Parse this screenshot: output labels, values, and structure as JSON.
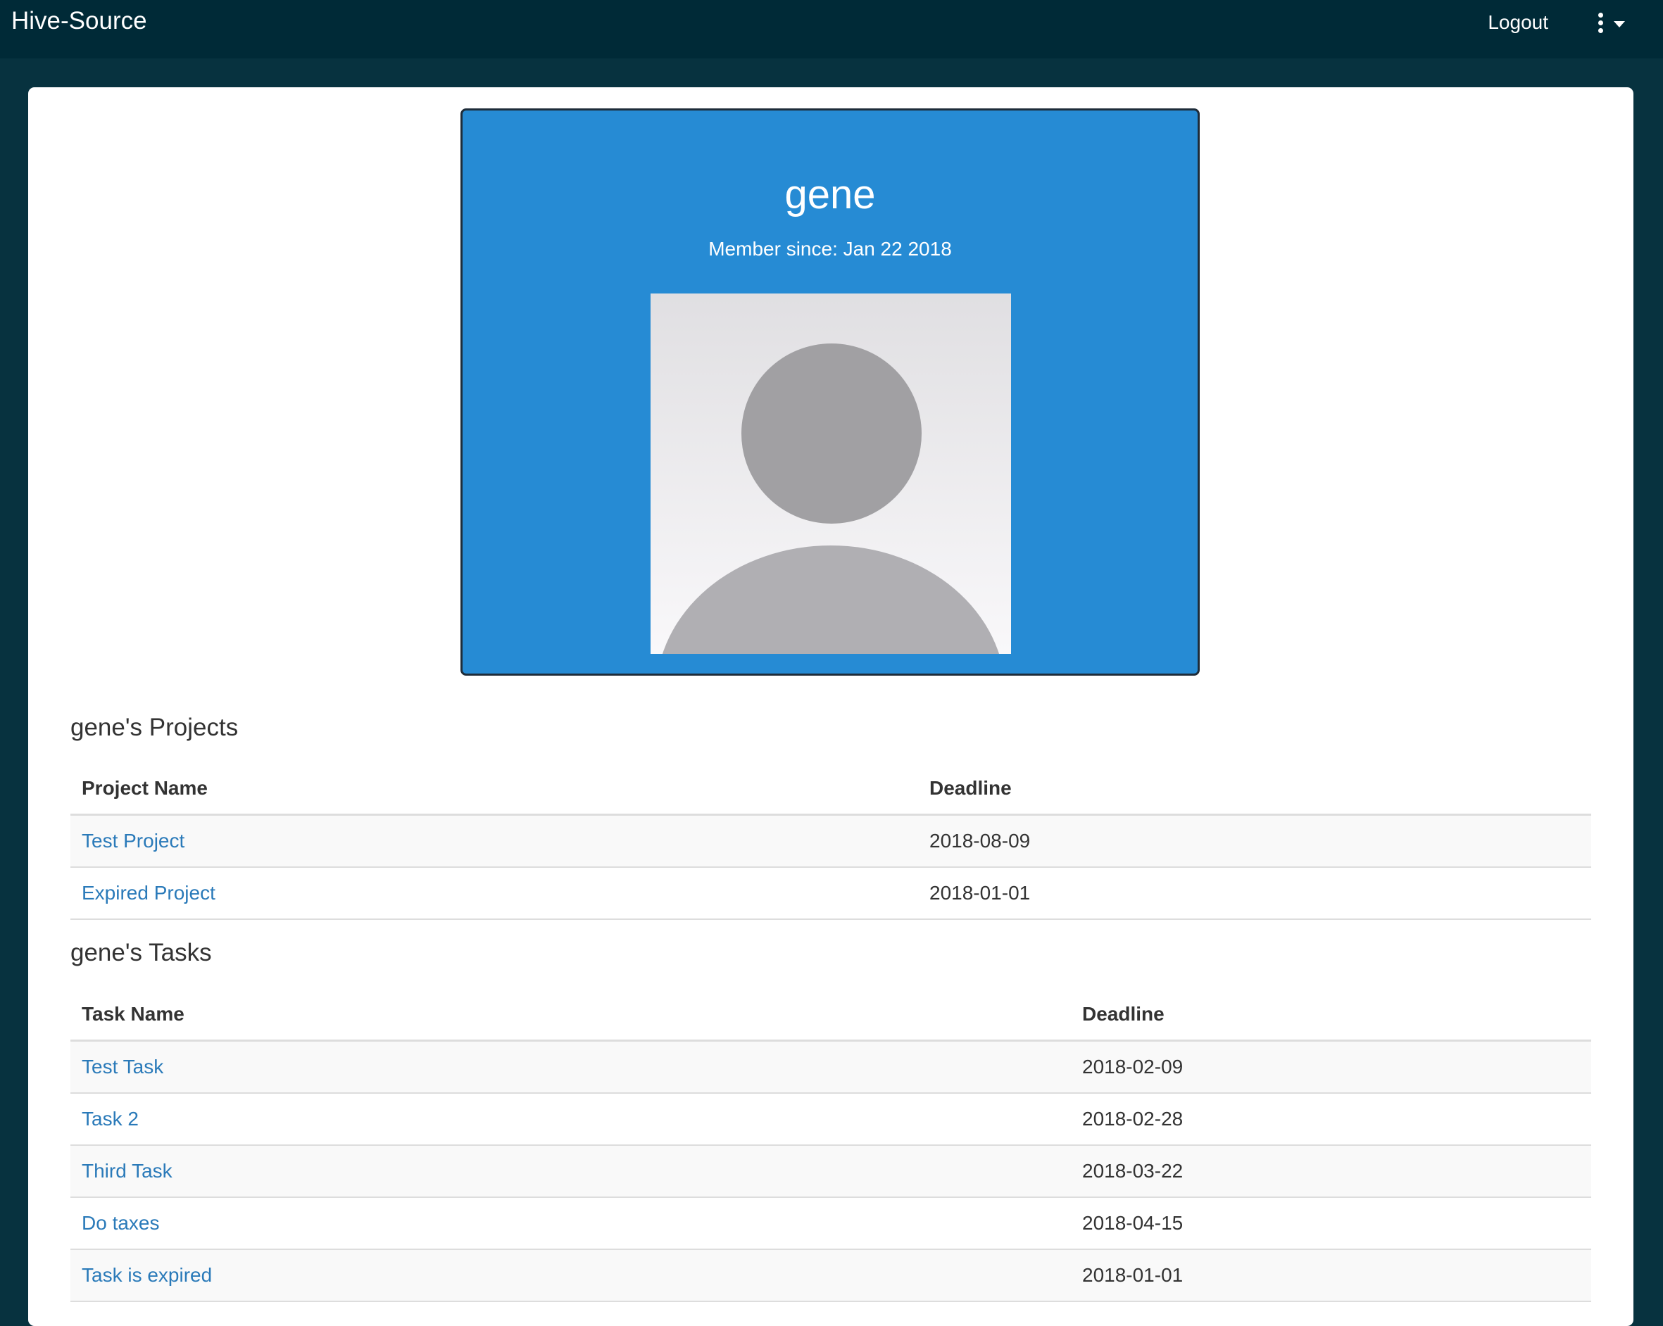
{
  "navbar": {
    "brand": "Hive-Source",
    "logout_label": "Logout",
    "menu_icon": "kebab-menu-icon"
  },
  "profile": {
    "name": "gene",
    "member_since": "Member since: Jan 22 2018",
    "avatar_icon": "default-avatar-placeholder"
  },
  "projects": {
    "title": "gene's Projects",
    "columns": [
      "Project Name",
      "Deadline"
    ],
    "rows": [
      {
        "name": "Test Project",
        "deadline": "2018-08-09"
      },
      {
        "name": "Expired Project",
        "deadline": "2018-01-01"
      }
    ]
  },
  "tasks": {
    "title": "gene's Tasks",
    "columns": [
      "Task Name",
      "Deadline"
    ],
    "rows": [
      {
        "name": "Test Task",
        "deadline": "2018-02-09"
      },
      {
        "name": "Task 2",
        "deadline": "2018-02-28"
      },
      {
        "name": "Third Task",
        "deadline": "2018-03-22"
      },
      {
        "name": "Do taxes",
        "deadline": "2018-04-15"
      },
      {
        "name": "Task is expired",
        "deadline": "2018-01-01"
      }
    ]
  },
  "colors": {
    "navbar_bg": "#002a37",
    "page_bg": "#07323f",
    "card_bg": "#268bd4",
    "link": "#2a7ab9"
  }
}
